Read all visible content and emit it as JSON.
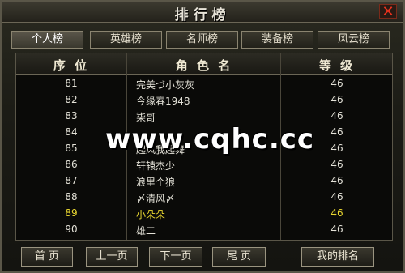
{
  "window": {
    "title": "排行榜",
    "close_label": "✕"
  },
  "tabs": [
    {
      "label": "个人榜",
      "active": true
    },
    {
      "label": "英雄榜",
      "active": false
    },
    {
      "label": "名师榜",
      "active": false
    },
    {
      "label": "装备榜",
      "active": false
    },
    {
      "label": "风云榜",
      "active": false
    }
  ],
  "table": {
    "headers": {
      "rank": "序 位",
      "name": "角 色 名",
      "level": "等 级"
    },
    "rows": [
      {
        "rank": "81",
        "name": "完美づ小灰灰",
        "level": "46"
      },
      {
        "rank": "82",
        "name": "今缘春1948",
        "level": "46"
      },
      {
        "rank": "83",
        "name": "柒哥",
        "level": "46"
      },
      {
        "rank": "84",
        "name": "",
        "level": "46"
      },
      {
        "rank": "85",
        "name": "起风我起舞",
        "level": "46"
      },
      {
        "rank": "86",
        "name": "轩辕杰少",
        "level": "46"
      },
      {
        "rank": "87",
        "name": "浪里个狼",
        "level": "46"
      },
      {
        "rank": "88",
        "name": "〆清风〆",
        "level": "46"
      },
      {
        "rank": "89",
        "name": "小朵朵",
        "level": "46"
      },
      {
        "rank": "90",
        "name": "雄二",
        "level": "46"
      }
    ],
    "highlight_rank": "89",
    "highlight_color": "#e8d630"
  },
  "buttons": {
    "first": "首 页",
    "prev": "上一页",
    "next": "下一页",
    "last": "尾 页",
    "my_rank": "我的排名"
  },
  "watermark": "www.cqhc.cc"
}
